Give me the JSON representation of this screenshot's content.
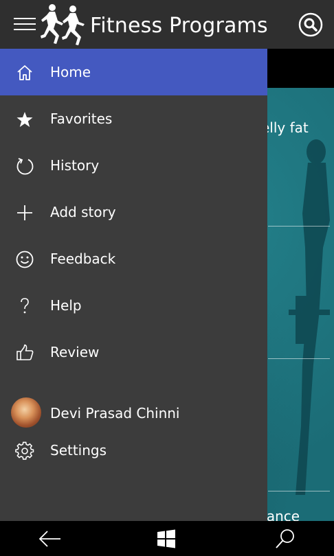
{
  "header": {
    "title": "Fitness Programs",
    "menu_icon": "hamburger-icon",
    "logo_icon": "runners-logo-icon",
    "search_icon": "search-circle-icon"
  },
  "drawer": {
    "items": [
      {
        "label": "Home",
        "icon": "home-icon",
        "active": true
      },
      {
        "label": "Favorites",
        "icon": "star-icon",
        "active": false
      },
      {
        "label": "History",
        "icon": "refresh-icon",
        "active": false
      },
      {
        "label": "Add story",
        "icon": "plus-icon",
        "active": false
      },
      {
        "label": "Feedback",
        "icon": "smiley-icon",
        "active": false
      },
      {
        "label": "Help",
        "icon": "question-icon",
        "active": false
      },
      {
        "label": "Review",
        "icon": "thumbs-up-icon",
        "active": false
      }
    ],
    "user": {
      "name": "Devi Prasad Chinni",
      "icon": "avatar"
    },
    "settings": {
      "label": "Settings",
      "icon": "gear-icon"
    }
  },
  "background": {
    "peek_texts": [
      "elly fat",
      "tance"
    ]
  },
  "system_bar": {
    "back_icon": "back-arrow-icon",
    "windows_icon": "windows-logo-icon",
    "search_icon": "search-icon"
  },
  "colors": {
    "header_bg": "#2f2f2f",
    "drawer_bg": "#3c3c3c",
    "active_item": "#4459c0",
    "content_teal": "#1b6c76"
  }
}
